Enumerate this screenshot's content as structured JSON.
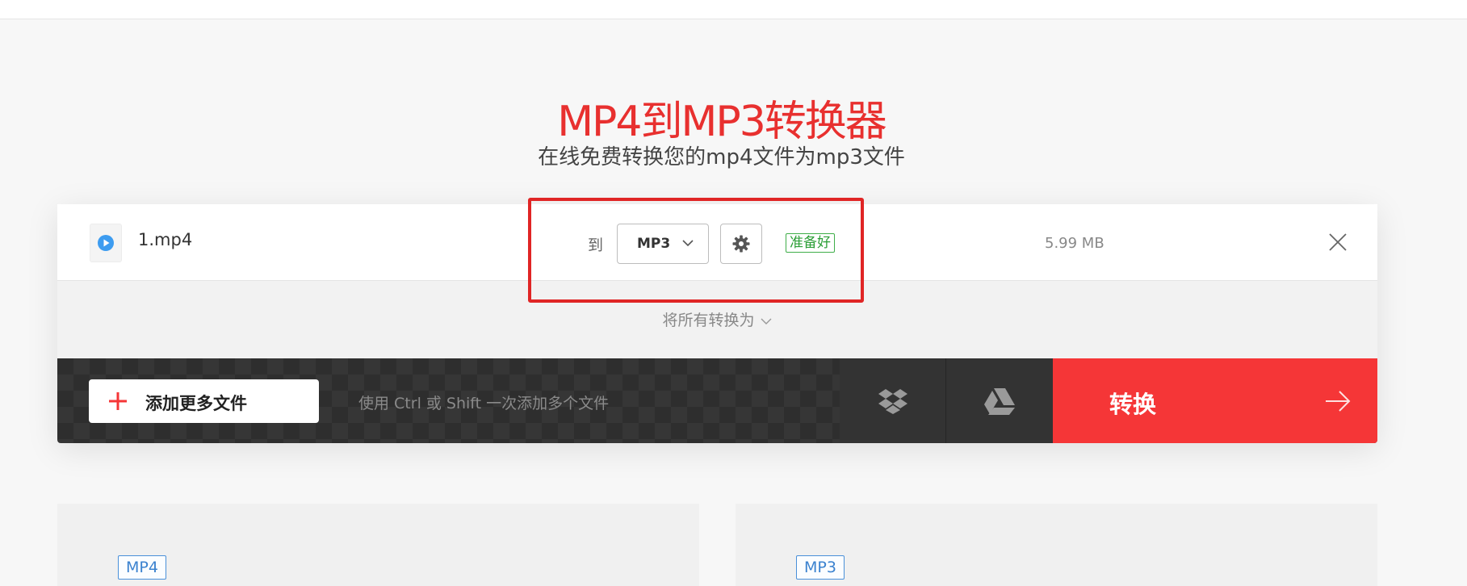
{
  "page": {
    "title": "MP4到MP3转换器",
    "subtitle": "在线免费转换您的mp4文件为mp3文件"
  },
  "file": {
    "name": "1.mp4",
    "to_label": "到",
    "target_format": "MP3",
    "status": "准备好",
    "size": "5.99 MB"
  },
  "convert_all": {
    "label": "将所有转换为"
  },
  "action_bar": {
    "add_files_label": "添加更多文件",
    "hint": "使用 Ctrl 或 Shift 一次添加多个文件",
    "convert_label": "转换"
  },
  "info": {
    "left_tag": "MP4",
    "right_tag": "MP3"
  },
  "colors": {
    "accent": "#f53637",
    "title": "#e8302f",
    "ready": "#2b9e36",
    "tag": "#3b82cf"
  },
  "icons": {
    "file": "play-circle-icon",
    "format_dropdown": "chevron-down-icon",
    "settings": "gear-icon",
    "remove": "close-icon",
    "convert_all": "chevron-down-icon",
    "add": "plus-icon",
    "dropbox": "dropbox-icon",
    "gdrive": "google-drive-icon",
    "convert": "arrow-right-icon"
  }
}
